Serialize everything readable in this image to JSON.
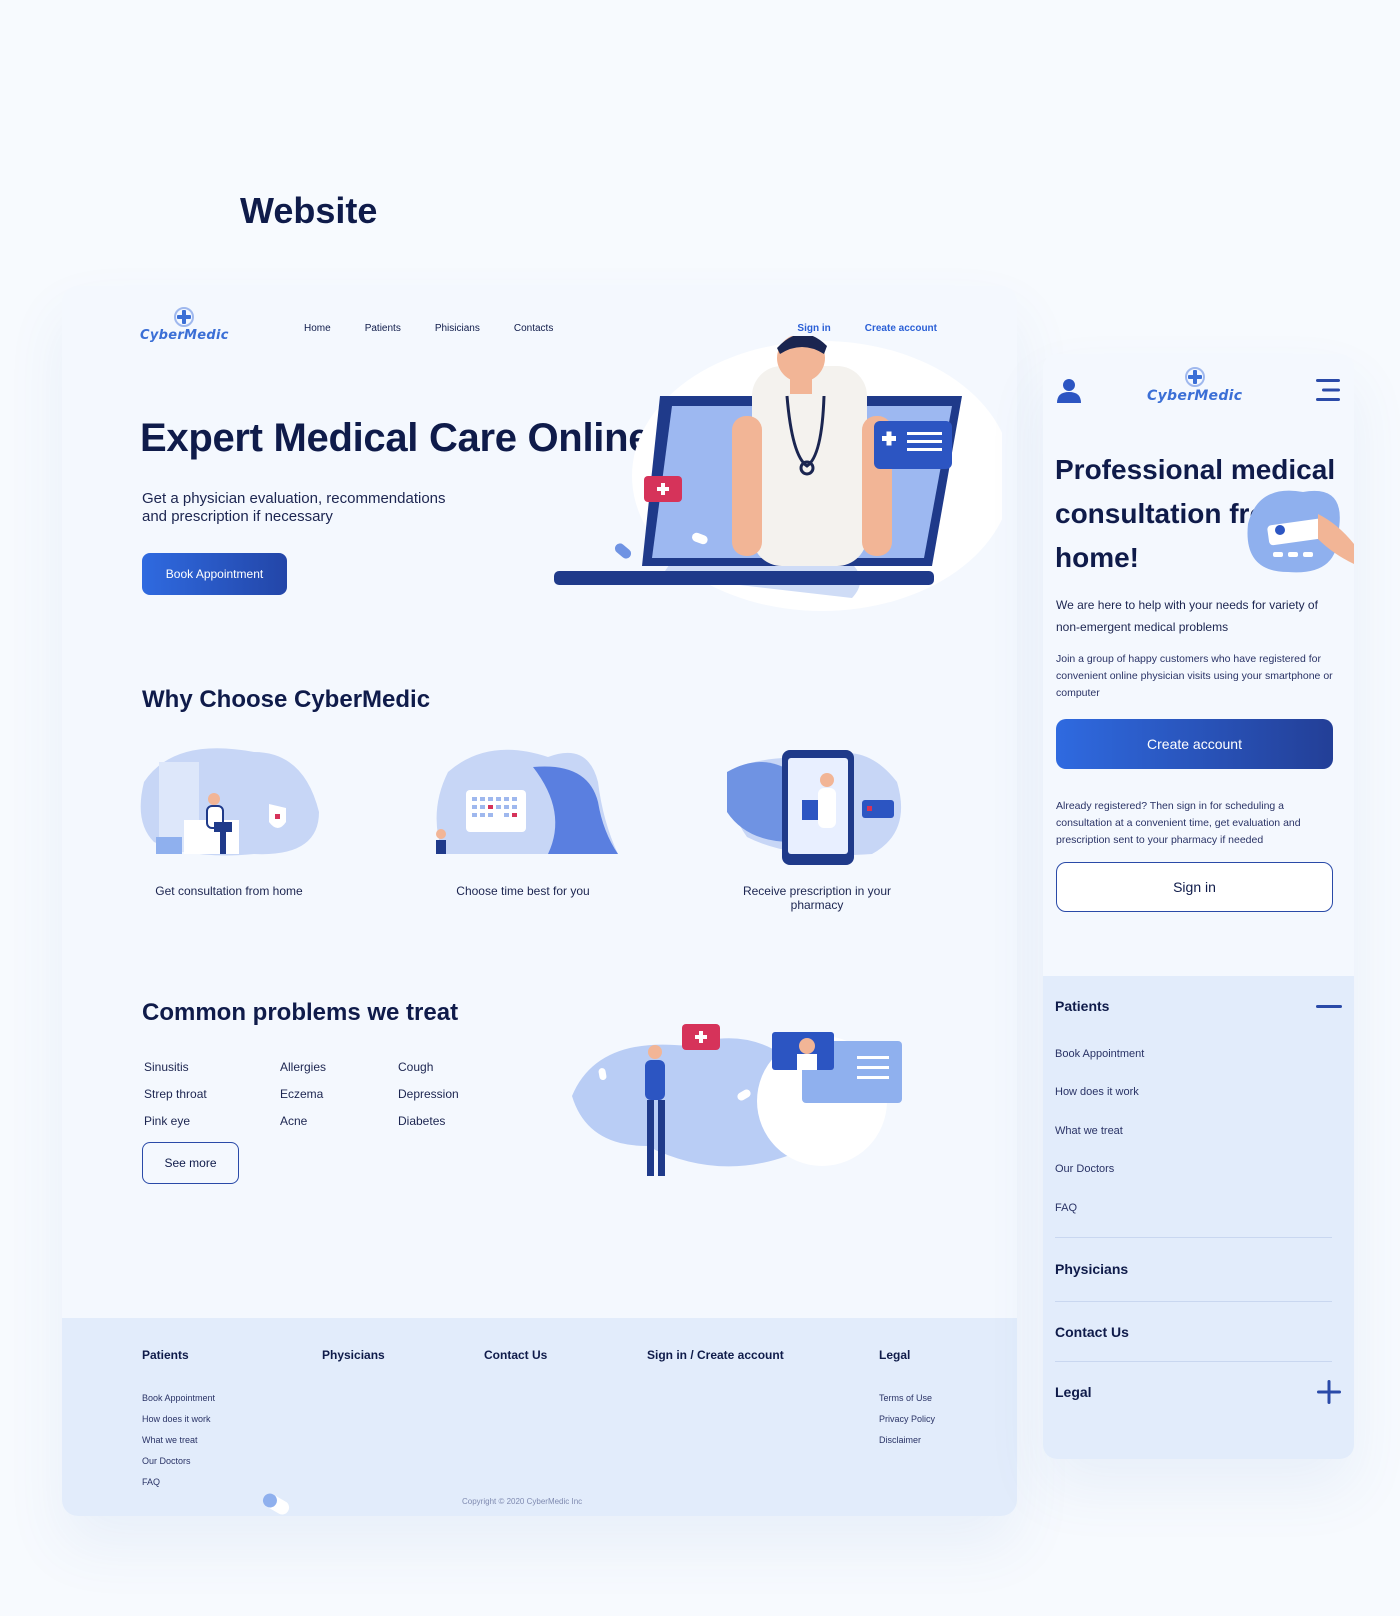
{
  "page_heading": "Website",
  "brand": "CyberMedic",
  "nav": [
    "Home",
    "Patients",
    "Phisicians",
    "Contacts"
  ],
  "auth": {
    "sign_in": "Sign in",
    "create": "Create account"
  },
  "hero": {
    "title": "Expert Medical Care Online",
    "subtitle": "Get a physician evaluation, recommendations and prescription if necessary",
    "cta": "Book Appointment"
  },
  "why": {
    "title": "Why Choose CyberMedic",
    "features": [
      "Get consultation from home",
      "Choose time best for you",
      "Receive prescription in your pharmacy"
    ]
  },
  "problems": {
    "title": "Common problems we treat",
    "items": [
      "Sinusitis",
      "Allergies",
      "Cough",
      "Strep throat",
      "Eczema",
      "Depression",
      "Pink eye",
      "Acne",
      "Diabetes"
    ],
    "more": "See more"
  },
  "footer": {
    "columns": [
      {
        "title": "Patients",
        "links": [
          "Book Appointment",
          "How does it work",
          "What we treat",
          "Our Doctors",
          "FAQ"
        ]
      },
      {
        "title": "Physicians",
        "links": []
      },
      {
        "title": "Contact Us",
        "links": []
      },
      {
        "title": "Sign in / Create account",
        "links": []
      },
      {
        "title": "Legal",
        "links": [
          "Terms of Use",
          "Privacy Policy",
          "Disclaimer"
        ]
      }
    ],
    "copyright": "Copyright © 2020 CyberMedic Inc"
  },
  "mobile": {
    "title": "Professional medical consultation from home!",
    "lead": "We are here to help with your needs for variety of non-emergent medical problems",
    "join": "Join a group of happy customers who have registered for convenient online physician visits using your smartphone or computer",
    "create": "Create account",
    "already": "Already registered? Then sign in for scheduling a consultation at a convenient time, get evaluation and prescription sent to your pharmacy if needed",
    "sign_in": "Sign in",
    "accordion": {
      "patients": "Patients",
      "patients_links": [
        "Book Appointment",
        "How does it work",
        "What we treat",
        "Our Doctors",
        "FAQ"
      ],
      "physicians": "Physicians",
      "contact": "Contact Us",
      "legal": "Legal"
    }
  },
  "colors": {
    "accent": "#2f6ae0",
    "navy": "#0f1b4a",
    "footer_bg": "#e2ecfb",
    "cross_red": "#d6335a"
  },
  "icons": [
    "logo-cross-icon",
    "user-icon",
    "hamburger-menu-icon",
    "minus-icon",
    "plus-icon"
  ]
}
